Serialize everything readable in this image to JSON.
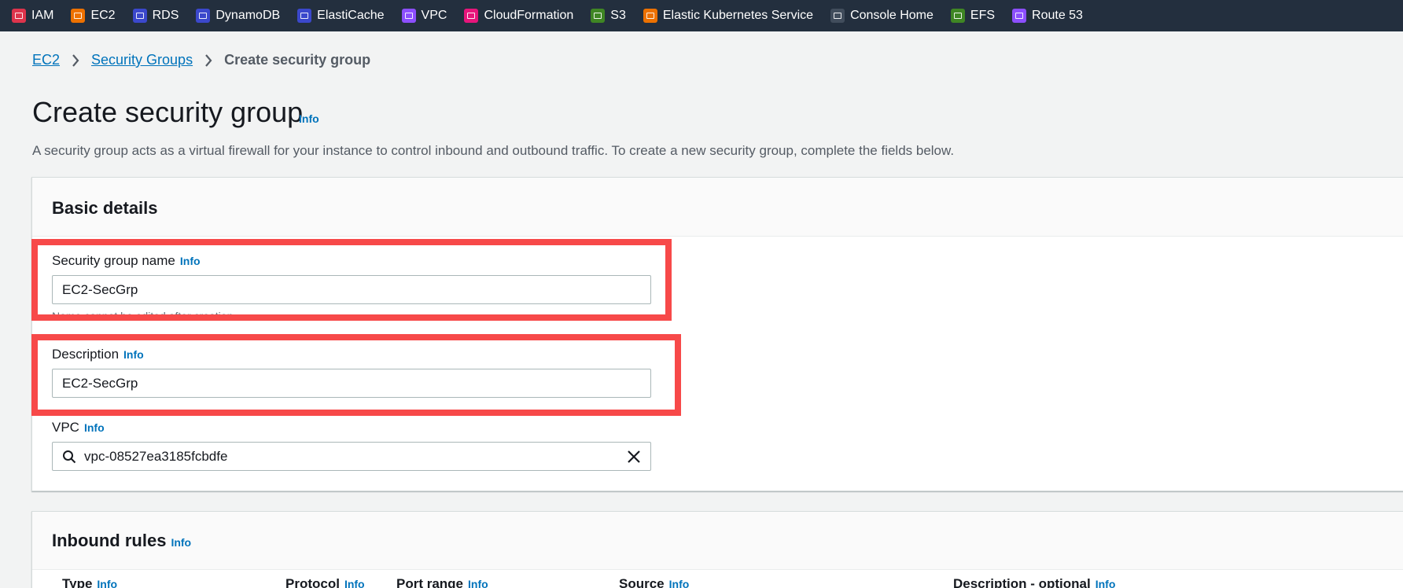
{
  "favorites": [
    {
      "label": "IAM",
      "icon": "iam-icon",
      "color": "#dd344c"
    },
    {
      "label": "EC2",
      "icon": "ec2-icon",
      "color": "#ed7100"
    },
    {
      "label": "RDS",
      "icon": "rds-icon",
      "color": "#3b48cc"
    },
    {
      "label": "DynamoDB",
      "icon": "dynamodb-icon",
      "color": "#3b48cc"
    },
    {
      "label": "ElastiCache",
      "icon": "elasticache-icon",
      "color": "#3b48cc"
    },
    {
      "label": "VPC",
      "icon": "vpc-icon",
      "color": "#8c4fff"
    },
    {
      "label": "CloudFormation",
      "icon": "cloudformation-icon",
      "color": "#e7157b"
    },
    {
      "label": "S3",
      "icon": "s3-icon",
      "color": "#3f8624"
    },
    {
      "label": "Elastic Kubernetes Service",
      "icon": "eks-icon",
      "color": "#ed7100"
    },
    {
      "label": "Console Home",
      "icon": "console-home-icon",
      "color": "#414d5c"
    },
    {
      "label": "EFS",
      "icon": "efs-icon",
      "color": "#3f8624"
    },
    {
      "label": "Route 53",
      "icon": "route53-icon",
      "color": "#8c4fff"
    }
  ],
  "breadcrumb": {
    "items": [
      "EC2",
      "Security Groups"
    ],
    "current": "Create security group"
  },
  "page": {
    "title": "Create security group",
    "title_info": "Info",
    "description": "A security group acts as a virtual firewall for your instance to control inbound and outbound traffic. To create a new security group, complete the fields below."
  },
  "basic_details": {
    "heading": "Basic details",
    "name_label": "Security group name",
    "name_info": "Info",
    "name_value": "EC2-SecGrp",
    "name_constraint": "Name cannot be edited after creation.",
    "description_label": "Description",
    "description_info": "Info",
    "description_value": "EC2-SecGrp",
    "vpc_label": "VPC",
    "vpc_info": "Info",
    "vpc_value": "vpc-08527ea3185fcbdfe"
  },
  "inbound": {
    "heading": "Inbound rules",
    "info": "Info",
    "columns": [
      {
        "label": "Type",
        "info": "Info"
      },
      {
        "label": "Protocol",
        "info": "Info"
      },
      {
        "label": "Port range",
        "info": "Info"
      },
      {
        "label": "Source",
        "info": "Info"
      },
      {
        "label": "Description - optional",
        "info": "Info"
      }
    ]
  },
  "colors": {
    "highlight": "#f74949",
    "link": "#0073bb",
    "topbar": "#232f3e"
  }
}
